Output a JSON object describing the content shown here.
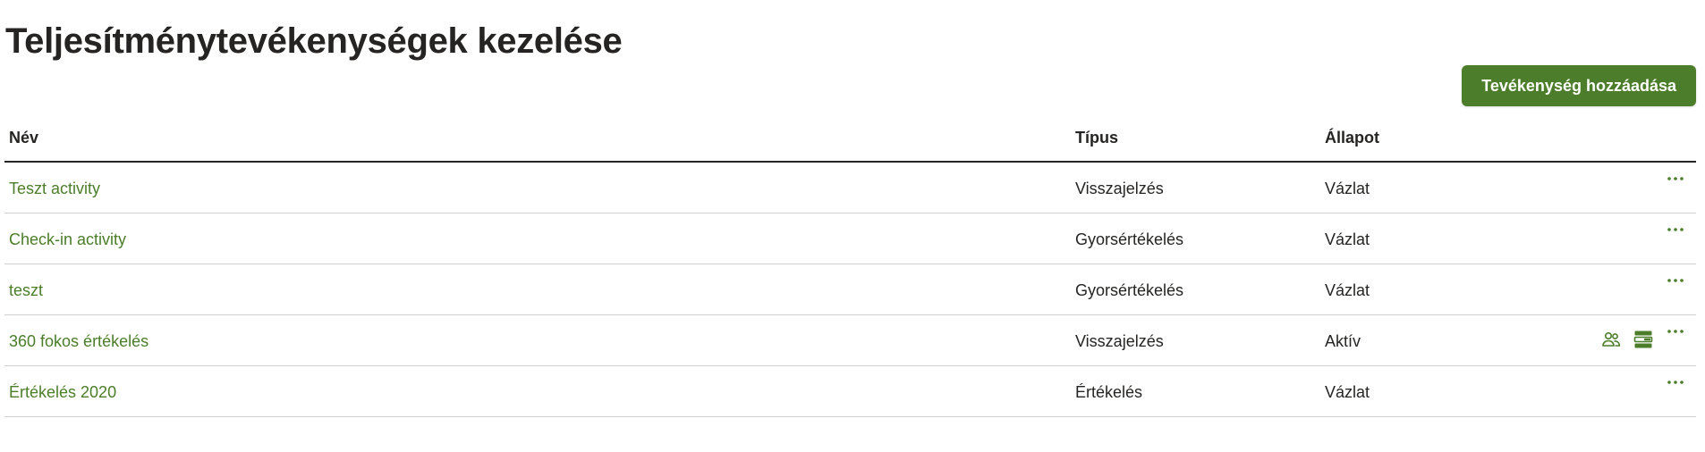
{
  "header": {
    "title": "Teljesítménytevékenységek kezelése",
    "add_button_label": "Tevékenység hozzáadása"
  },
  "table": {
    "columns": {
      "name": "Név",
      "type": "Típus",
      "status": "Állapot"
    },
    "rows": [
      {
        "name": "Teszt activity",
        "type": "Visszajelzés",
        "status": "Vázlat",
        "extra_icons": []
      },
      {
        "name": "Check-in activity",
        "type": "Gyorsértékelés",
        "status": "Vázlat",
        "extra_icons": []
      },
      {
        "name": "teszt",
        "type": "Gyorsértékelés",
        "status": "Vázlat",
        "extra_icons": []
      },
      {
        "name": "360 fokos értékelés",
        "type": "Visszajelzés",
        "status": "Aktív",
        "extra_icons": [
          "people-icon",
          "list-details-icon"
        ]
      },
      {
        "name": "Értékelés 2020",
        "type": "Értékelés",
        "status": "Vázlat",
        "extra_icons": []
      }
    ]
  },
  "colors": {
    "accent": "#4b7d2a",
    "text": "#252423",
    "divider": "#d2d0ce"
  }
}
